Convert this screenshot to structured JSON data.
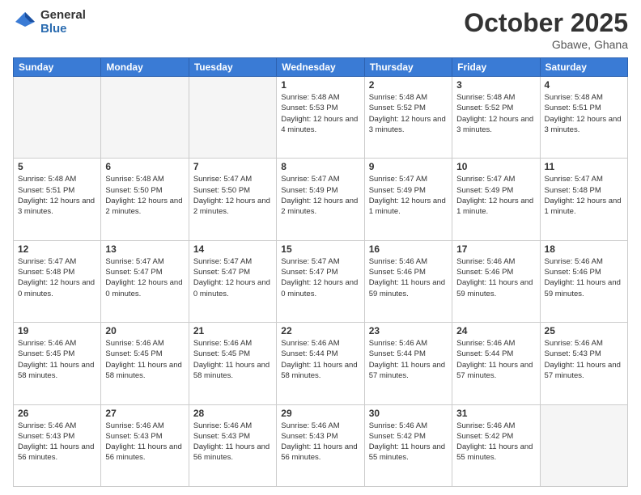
{
  "header": {
    "logo_general": "General",
    "logo_blue": "Blue",
    "month_title": "October 2025",
    "location": "Gbawe, Ghana"
  },
  "days_of_week": [
    "Sunday",
    "Monday",
    "Tuesday",
    "Wednesday",
    "Thursday",
    "Friday",
    "Saturday"
  ],
  "weeks": [
    [
      {
        "day": "",
        "empty": true
      },
      {
        "day": "",
        "empty": true
      },
      {
        "day": "",
        "empty": true
      },
      {
        "day": "1",
        "sunrise": "Sunrise: 5:48 AM",
        "sunset": "Sunset: 5:53 PM",
        "daylight": "Daylight: 12 hours and 4 minutes."
      },
      {
        "day": "2",
        "sunrise": "Sunrise: 5:48 AM",
        "sunset": "Sunset: 5:52 PM",
        "daylight": "Daylight: 12 hours and 3 minutes."
      },
      {
        "day": "3",
        "sunrise": "Sunrise: 5:48 AM",
        "sunset": "Sunset: 5:52 PM",
        "daylight": "Daylight: 12 hours and 3 minutes."
      },
      {
        "day": "4",
        "sunrise": "Sunrise: 5:48 AM",
        "sunset": "Sunset: 5:51 PM",
        "daylight": "Daylight: 12 hours and 3 minutes."
      }
    ],
    [
      {
        "day": "5",
        "sunrise": "Sunrise: 5:48 AM",
        "sunset": "Sunset: 5:51 PM",
        "daylight": "Daylight: 12 hours and 3 minutes."
      },
      {
        "day": "6",
        "sunrise": "Sunrise: 5:48 AM",
        "sunset": "Sunset: 5:50 PM",
        "daylight": "Daylight: 12 hours and 2 minutes."
      },
      {
        "day": "7",
        "sunrise": "Sunrise: 5:47 AM",
        "sunset": "Sunset: 5:50 PM",
        "daylight": "Daylight: 12 hours and 2 minutes."
      },
      {
        "day": "8",
        "sunrise": "Sunrise: 5:47 AM",
        "sunset": "Sunset: 5:49 PM",
        "daylight": "Daylight: 12 hours and 2 minutes."
      },
      {
        "day": "9",
        "sunrise": "Sunrise: 5:47 AM",
        "sunset": "Sunset: 5:49 PM",
        "daylight": "Daylight: 12 hours and 1 minute."
      },
      {
        "day": "10",
        "sunrise": "Sunrise: 5:47 AM",
        "sunset": "Sunset: 5:49 PM",
        "daylight": "Daylight: 12 hours and 1 minute."
      },
      {
        "day": "11",
        "sunrise": "Sunrise: 5:47 AM",
        "sunset": "Sunset: 5:48 PM",
        "daylight": "Daylight: 12 hours and 1 minute."
      }
    ],
    [
      {
        "day": "12",
        "sunrise": "Sunrise: 5:47 AM",
        "sunset": "Sunset: 5:48 PM",
        "daylight": "Daylight: 12 hours and 0 minutes."
      },
      {
        "day": "13",
        "sunrise": "Sunrise: 5:47 AM",
        "sunset": "Sunset: 5:47 PM",
        "daylight": "Daylight: 12 hours and 0 minutes."
      },
      {
        "day": "14",
        "sunrise": "Sunrise: 5:47 AM",
        "sunset": "Sunset: 5:47 PM",
        "daylight": "Daylight: 12 hours and 0 minutes."
      },
      {
        "day": "15",
        "sunrise": "Sunrise: 5:47 AM",
        "sunset": "Sunset: 5:47 PM",
        "daylight": "Daylight: 12 hours and 0 minutes."
      },
      {
        "day": "16",
        "sunrise": "Sunrise: 5:46 AM",
        "sunset": "Sunset: 5:46 PM",
        "daylight": "Daylight: 11 hours and 59 minutes."
      },
      {
        "day": "17",
        "sunrise": "Sunrise: 5:46 AM",
        "sunset": "Sunset: 5:46 PM",
        "daylight": "Daylight: 11 hours and 59 minutes."
      },
      {
        "day": "18",
        "sunrise": "Sunrise: 5:46 AM",
        "sunset": "Sunset: 5:46 PM",
        "daylight": "Daylight: 11 hours and 59 minutes."
      }
    ],
    [
      {
        "day": "19",
        "sunrise": "Sunrise: 5:46 AM",
        "sunset": "Sunset: 5:45 PM",
        "daylight": "Daylight: 11 hours and 58 minutes."
      },
      {
        "day": "20",
        "sunrise": "Sunrise: 5:46 AM",
        "sunset": "Sunset: 5:45 PM",
        "daylight": "Daylight: 11 hours and 58 minutes."
      },
      {
        "day": "21",
        "sunrise": "Sunrise: 5:46 AM",
        "sunset": "Sunset: 5:45 PM",
        "daylight": "Daylight: 11 hours and 58 minutes."
      },
      {
        "day": "22",
        "sunrise": "Sunrise: 5:46 AM",
        "sunset": "Sunset: 5:44 PM",
        "daylight": "Daylight: 11 hours and 58 minutes."
      },
      {
        "day": "23",
        "sunrise": "Sunrise: 5:46 AM",
        "sunset": "Sunset: 5:44 PM",
        "daylight": "Daylight: 11 hours and 57 minutes."
      },
      {
        "day": "24",
        "sunrise": "Sunrise: 5:46 AM",
        "sunset": "Sunset: 5:44 PM",
        "daylight": "Daylight: 11 hours and 57 minutes."
      },
      {
        "day": "25",
        "sunrise": "Sunrise: 5:46 AM",
        "sunset": "Sunset: 5:43 PM",
        "daylight": "Daylight: 11 hours and 57 minutes."
      }
    ],
    [
      {
        "day": "26",
        "sunrise": "Sunrise: 5:46 AM",
        "sunset": "Sunset: 5:43 PM",
        "daylight": "Daylight: 11 hours and 56 minutes."
      },
      {
        "day": "27",
        "sunrise": "Sunrise: 5:46 AM",
        "sunset": "Sunset: 5:43 PM",
        "daylight": "Daylight: 11 hours and 56 minutes."
      },
      {
        "day": "28",
        "sunrise": "Sunrise: 5:46 AM",
        "sunset": "Sunset: 5:43 PM",
        "daylight": "Daylight: 11 hours and 56 minutes."
      },
      {
        "day": "29",
        "sunrise": "Sunrise: 5:46 AM",
        "sunset": "Sunset: 5:43 PM",
        "daylight": "Daylight: 11 hours and 56 minutes."
      },
      {
        "day": "30",
        "sunrise": "Sunrise: 5:46 AM",
        "sunset": "Sunset: 5:42 PM",
        "daylight": "Daylight: 11 hours and 55 minutes."
      },
      {
        "day": "31",
        "sunrise": "Sunrise: 5:46 AM",
        "sunset": "Sunset: 5:42 PM",
        "daylight": "Daylight: 11 hours and 55 minutes."
      },
      {
        "day": "",
        "empty": true
      }
    ]
  ]
}
